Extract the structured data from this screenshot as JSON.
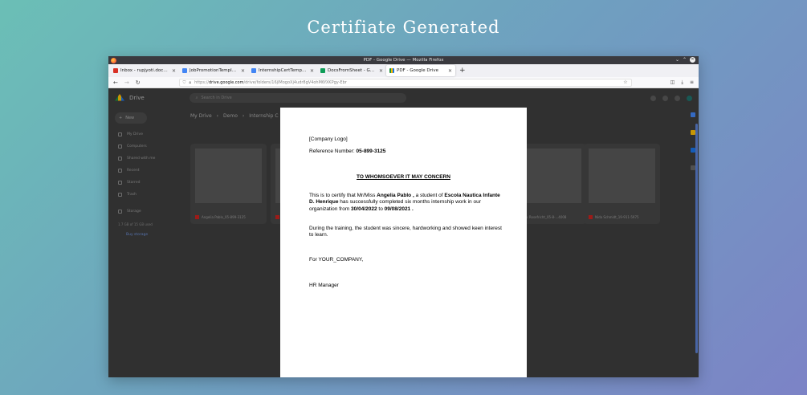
{
  "headline": "Certifiate Generated",
  "window_title": "PDF - Google Drive — Mozilla Firefox",
  "tabs": [
    {
      "label": "Inbox - rupjyoti.docsfrom",
      "color": "#d93025",
      "active": false
    },
    {
      "label": "JobPromotionTemplate - G",
      "color": "#4285f4",
      "active": false
    },
    {
      "label": "InternshipCertTemplate - G",
      "color": "#4285f4",
      "active": false
    },
    {
      "label": "DocsFromSheet - Google S",
      "color": "#0f9d58",
      "active": false
    },
    {
      "label": "PDF - Google Drive",
      "color": "#fbbc04",
      "active": true
    }
  ],
  "url": {
    "prefix": "https://",
    "domain": "drive.google.com",
    "path": "/drive/folders/16jlMogoXj4udr8gV4ohM6fXKPgy-Ebr"
  },
  "drive": {
    "app_name": "Drive",
    "search_placeholder": "Search in Drive",
    "new_label": "New",
    "sidebar": [
      "My Drive",
      "Computers",
      "Shared with me",
      "Recent",
      "Starred",
      "Trash",
      "Storage"
    ],
    "storage_text": "1.7 GB of 15 GB used",
    "buy_storage": "Buy storage",
    "breadcrumb": [
      "My Drive",
      "Demo",
      "Internship C"
    ],
    "files": [
      {
        "name": "Angelia Pablo_05-899-3125"
      },
      {
        "name": ""
      },
      {
        "name": "Nick Rosefricht_05-8-...4008"
      },
      {
        "name": "Nida Schmidt_19-911-5975"
      }
    ]
  },
  "certificate": {
    "logo_placeholder": "[Company Logo]",
    "ref_label": "Reference Number:",
    "ref_number": "05-899-3125",
    "heading": "TO WHOMSOEVER IT MAY CONCERN",
    "p1_a": "This is to certify that Mr/Miss",
    "p1_name": "Angelia Pablo ,",
    "p1_b": "a student of",
    "p1_school_1": "Escola Nautica Infante D.",
    "p1_school_2": "Henrique",
    "p1_c": "has successfully completed six months internship work in our organization",
    "p1_from": "from",
    "p1_start": "30/04/2022",
    "p1_to": "to",
    "p1_end": "09/08/2021 .",
    "p2": "During the training, the student was sincere, hardworking and showed keen interest to learn.",
    "sign_company": "For YOUR_COMPANY,",
    "sign_role": "HR Manager"
  }
}
